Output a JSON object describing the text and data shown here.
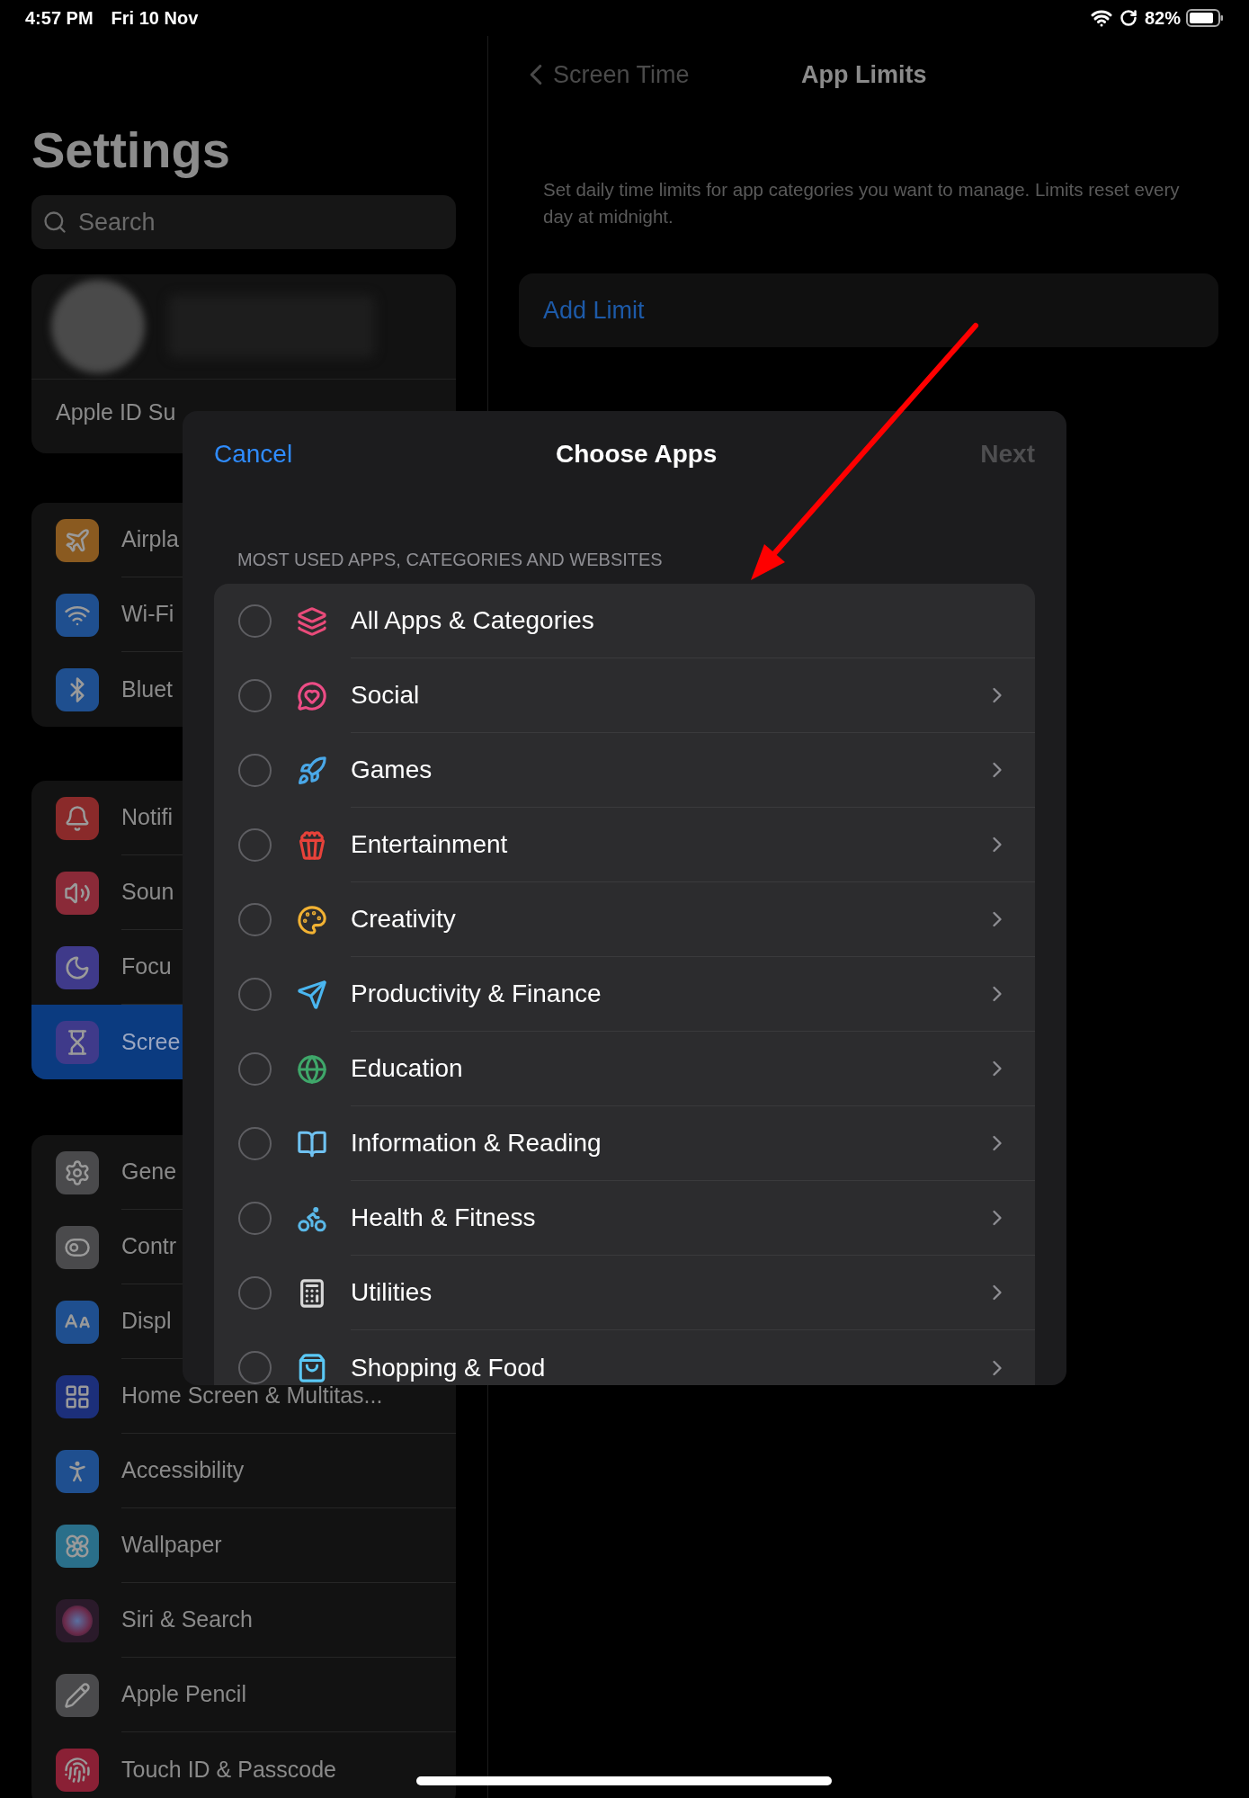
{
  "status_bar": {
    "time": "4:57 PM",
    "date": "Fri 10 Nov",
    "battery": "82%"
  },
  "sidebar": {
    "title": "Settings",
    "search": {
      "placeholder": "Search"
    },
    "profile": {
      "suggestion": "Apple ID Su"
    },
    "groups": [
      {
        "items": [
          {
            "label": "Airpla",
            "selected": false
          },
          {
            "label": "Wi-Fi",
            "selected": false
          },
          {
            "label": "Bluet",
            "selected": false
          }
        ]
      },
      {
        "items": [
          {
            "label": "Notifi",
            "selected": false
          },
          {
            "label": "Soun",
            "selected": false
          },
          {
            "label": "Focu",
            "selected": false
          },
          {
            "label": "Scree",
            "selected": true
          }
        ]
      },
      {
        "items": [
          {
            "label": "Gene",
            "selected": false
          },
          {
            "label": "Contr",
            "selected": false
          },
          {
            "label": "Displ",
            "selected": false
          },
          {
            "label": "Home Screen & Multitas...",
            "selected": false
          },
          {
            "label": "Accessibility",
            "selected": false
          },
          {
            "label": "Wallpaper",
            "selected": false
          },
          {
            "label": "Siri & Search",
            "selected": false
          },
          {
            "label": "Apple Pencil",
            "selected": false
          },
          {
            "label": "Touch ID & Passcode",
            "selected": false
          }
        ]
      }
    ]
  },
  "detail": {
    "back": "Screen Time",
    "title": "App Limits",
    "description": "Set daily time limits for app categories you want to manage. Limits reset every day at midnight.",
    "add_limit": "Add Limit"
  },
  "modal": {
    "cancel": "Cancel",
    "title": "Choose Apps",
    "next": "Next",
    "next_disabled": true,
    "section_header": "MOST USED APPS, CATEGORIES AND WEBSITES",
    "rows": [
      {
        "label": "All Apps & Categories",
        "selected": false,
        "chevron": false
      },
      {
        "label": "Social",
        "selected": false,
        "chevron": true
      },
      {
        "label": "Games",
        "selected": false,
        "chevron": true
      },
      {
        "label": "Entertainment",
        "selected": false,
        "chevron": true
      },
      {
        "label": "Creativity",
        "selected": false,
        "chevron": true
      },
      {
        "label": "Productivity & Finance",
        "selected": false,
        "chevron": true
      },
      {
        "label": "Education",
        "selected": false,
        "chevron": true
      },
      {
        "label": "Information & Reading",
        "selected": false,
        "chevron": true
      },
      {
        "label": "Health & Fitness",
        "selected": false,
        "chevron": true
      },
      {
        "label": "Utilities",
        "selected": false,
        "chevron": true
      },
      {
        "label": "Shopping & Food",
        "selected": false,
        "chevron": true
      }
    ]
  }
}
